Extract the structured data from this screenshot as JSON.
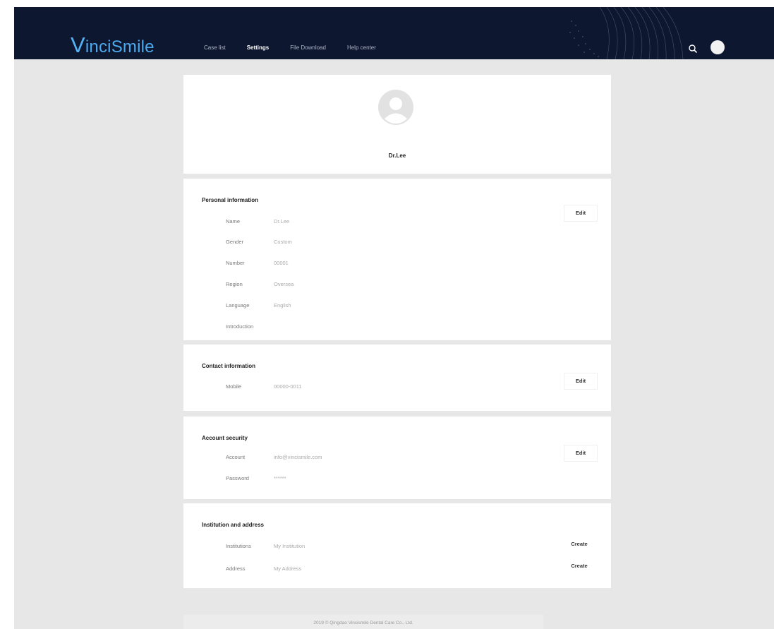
{
  "header": {
    "logo_initial": "V",
    "logo_rest": "inciSmile",
    "nav": [
      "Case list",
      "Settings",
      "File Download",
      "Help center"
    ],
    "active_nav": "Settings",
    "background": "#0e1730",
    "accent": "#4da9ee",
    "icons": [
      "search-icon",
      "user-avatar"
    ]
  },
  "profile": {
    "name": "Dr.Lee",
    "icon": "default-avatar-icon"
  },
  "personal": {
    "title": "Personal information",
    "edit_label": "Edit",
    "rows": [
      {
        "label": "Name",
        "value": "Dr.Lee"
      },
      {
        "label": "Gender",
        "value": "Custom"
      },
      {
        "label": "Number",
        "value": "00001"
      },
      {
        "label": "Region",
        "value": "Oversea"
      },
      {
        "label": "Language",
        "value": "English"
      },
      {
        "label": "Introduction",
        "value": ""
      }
    ]
  },
  "contact": {
    "title": "Contact information",
    "edit_label": "Edit",
    "rows": [
      {
        "label": "Mobile",
        "value": "00000-0011"
      }
    ]
  },
  "security": {
    "title": "Account security",
    "edit_label": "Edit",
    "rows": [
      {
        "label": "Account",
        "value": "info@vincismile.com"
      },
      {
        "label": "Password",
        "value": "******"
      }
    ]
  },
  "institution": {
    "title": "Institution and address",
    "rows": [
      {
        "label": "Institutions",
        "value": "My Institution  ",
        "action": "Create"
      },
      {
        "label": "Address",
        "value": "My Address  ",
        "action": "Create"
      }
    ]
  },
  "footer": {
    "text": "2019 © Qingdao Vincismile Dental Care Co., Ltd."
  }
}
